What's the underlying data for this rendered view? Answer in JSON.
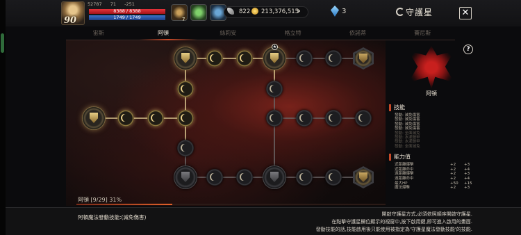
{
  "player": {
    "level": "90",
    "stat_a": "52787",
    "stat_b": "71",
    "stat_c": "-251",
    "hp": "8388 / 8388",
    "mp": "1749 / 1749"
  },
  "buffs": {
    "count": "7"
  },
  "currency": {
    "feather": "822",
    "gold": "213,376,515",
    "crystal": "3"
  },
  "window": {
    "title": "守護星",
    "close": "✕"
  },
  "tabs": [
    {
      "label": "宙斯"
    },
    {
      "label": "阿頓"
    },
    {
      "label": "絲莉安"
    },
    {
      "label": "格立特"
    },
    {
      "label": "依諾蒂"
    },
    {
      "label": "賽尼斯"
    }
  ],
  "active_tab": 1,
  "board": {
    "progress_label": "阿頓 [9/29] 31%",
    "progress": 0.31
  },
  "panel": {
    "help": "?",
    "emblem_name": "阿頓",
    "skills_title": "技能",
    "skills": [
      {
        "label": "發動: 減免傷害",
        "on": true
      },
      {
        "label": "發動: 減免傷害",
        "on": true
      },
      {
        "label": "發動: 減免傷害",
        "on": true
      },
      {
        "label": "發動: 減免傷害",
        "on": true
      },
      {
        "label": "發動: 全面減免",
        "on": false
      },
      {
        "label": "發動: 水漾鎧甲",
        "on": false
      },
      {
        "label": "發動: 水漾鎧甲",
        "on": false
      },
      {
        "label": "發動: 全面減免",
        "on": false
      }
    ],
    "stats_title": "能力值",
    "stats": [
      {
        "label": "近距離爆擊",
        "a": "+2",
        "b": "+3"
      },
      {
        "label": "近距離命中",
        "a": "+2",
        "b": "+4"
      },
      {
        "label": "遠距離爆擊",
        "a": "+2",
        "b": "+3"
      },
      {
        "label": "遠距離命中",
        "a": "+2",
        "b": "+4"
      },
      {
        "label": "最大HP",
        "a": "+50",
        "b": "+15"
      },
      {
        "label": "魔法爆擊",
        "a": "+2",
        "b": "+3"
      }
    ]
  },
  "footer": {
    "skill_line": "阿頓魔法發動技能:(減免傷害)",
    "info_lines": [
      "開啟守護星方式,必須依照順序開啟守護星.",
      "在點擊守護星欄位顯示的視窗中,按下啟用鍵,即可進入啟用的畫面.",
      "發動技能的話,技能啟用後只能使用被指定為'守護星魔法發動技能'的技能."
    ]
  }
}
